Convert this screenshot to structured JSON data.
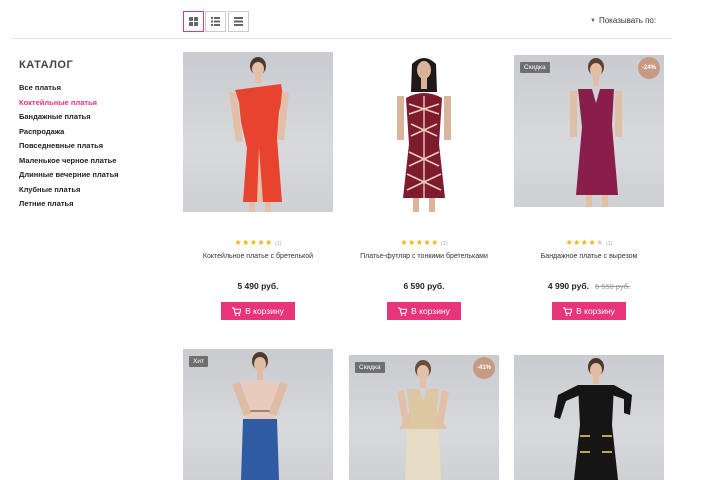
{
  "toolbar": {
    "sort_label": "Показывать по:",
    "views": [
      "grid-icon",
      "list-icon",
      "compact-list-icon"
    ]
  },
  "sidebar": {
    "title": "КАТАЛОГ",
    "items": [
      {
        "label": "Все платья",
        "active": false
      },
      {
        "label": "Коктейльные платья",
        "active": true
      },
      {
        "label": "Бандажные платья",
        "active": false
      },
      {
        "label": "Распродажа",
        "active": false
      },
      {
        "label": "Повседневные платья",
        "active": false
      },
      {
        "label": "Маленькое черное платье",
        "active": false
      },
      {
        "label": "Длинные вечерние платья",
        "active": false
      },
      {
        "label": "Клубные платья",
        "active": false
      },
      {
        "label": "Летние платья",
        "active": false
      }
    ]
  },
  "products": [
    {
      "name": "Коктейльное платье с бретелькой",
      "rating": 5,
      "reviews": "(1)",
      "price": "5 490 руб.",
      "old_price": "",
      "badge": "",
      "discount": "",
      "cart_label": "В корзину"
    },
    {
      "name": "Платье-футляр с тонкими бретельками",
      "rating": 5,
      "reviews": "(1)",
      "price": "6 590 руб.",
      "old_price": "",
      "badge": "",
      "discount": "",
      "cart_label": "В корзину"
    },
    {
      "name": "Бандажное платье с вырезом",
      "rating": 4,
      "reviews": "(1)",
      "price": "4 990 руб.",
      "old_price": "6 550 руб.",
      "badge": "Скидка",
      "discount": "-24%",
      "cart_label": "В корзину"
    },
    {
      "name": "",
      "rating": 0,
      "reviews": "",
      "price": "",
      "old_price": "",
      "badge": "Хит",
      "discount": "",
      "cart_label": ""
    },
    {
      "name": "",
      "rating": 0,
      "reviews": "",
      "price": "",
      "old_price": "",
      "badge": "Скидка",
      "discount": "-41%",
      "cart_label": ""
    },
    {
      "name": "",
      "rating": 0,
      "reviews": "",
      "price": "",
      "old_price": "",
      "badge": "",
      "discount": "",
      "cart_label": ""
    }
  ],
  "colors": {
    "accent": "#e8347a",
    "badge": "#6f6f6f",
    "discount_badge": "#c79a84",
    "star": "#f1b400"
  }
}
